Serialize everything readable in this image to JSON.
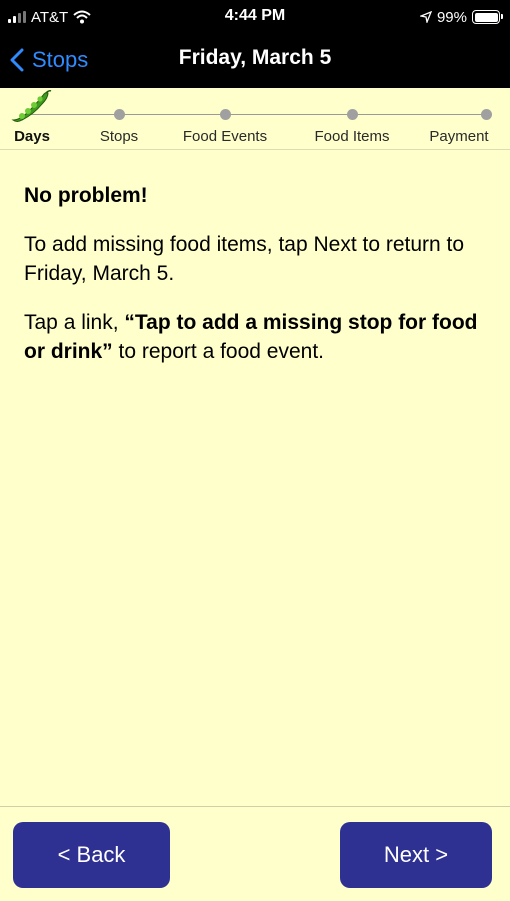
{
  "status_bar": {
    "carrier": "AT&T",
    "time": "4:44 PM",
    "battery": "99%"
  },
  "nav": {
    "back_label": "Stops",
    "title": "Friday, March 5"
  },
  "stepper": {
    "steps": [
      "Days",
      "Stops",
      "Food Events",
      "Food Items",
      "Payment"
    ],
    "active_step": "Days"
  },
  "content": {
    "heading": "No problem!",
    "para1": "To add missing food items, tap Next to return to Friday, March 5.",
    "para2_prefix": "Tap a link, ",
    "para2_link": "“Tap to add a missing stop for food or drink”",
    "para2_suffix": " to report a food event."
  },
  "footer": {
    "back_label": "< Back",
    "next_label": "Next >"
  },
  "colors": {
    "background": "#ffffcc",
    "button": "#2e3192",
    "nav_link": "#2f8cff"
  }
}
